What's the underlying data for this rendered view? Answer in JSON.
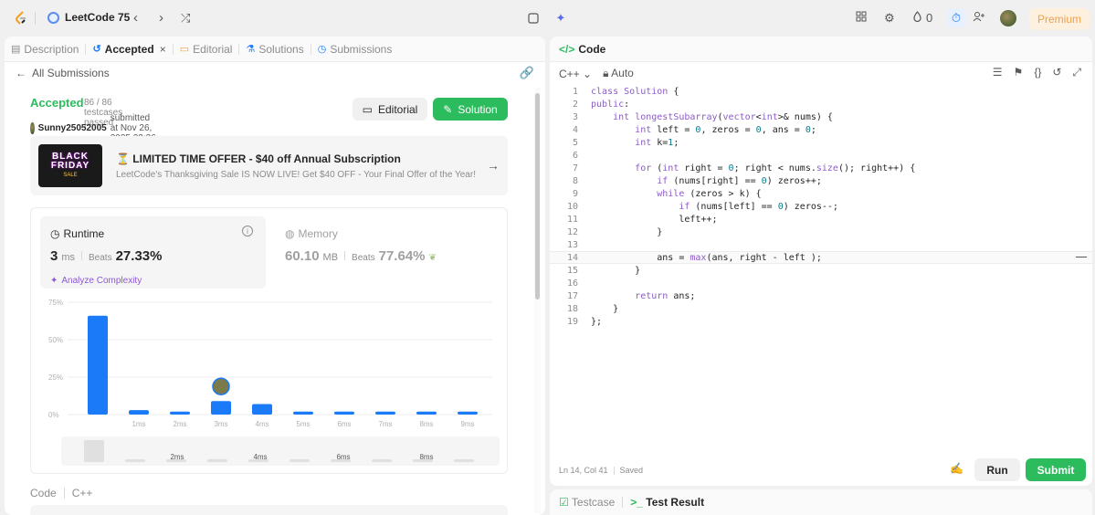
{
  "topbar": {
    "title": "LeetCode 75",
    "nav_prev": "‹",
    "nav_next": "›",
    "shuffle": "⤮",
    "streak_count": "0",
    "premium_label": "Premium"
  },
  "left_tabs": [
    {
      "label": "Description",
      "icon": "description-icon"
    },
    {
      "label": "Accepted",
      "icon": "history-icon"
    },
    {
      "label": "Editorial",
      "icon": "book-icon"
    },
    {
      "label": "Solutions",
      "icon": "flask-icon"
    },
    {
      "label": "Submissions",
      "icon": "clock-icon"
    }
  ],
  "left_tabs_close": "×",
  "submission": {
    "back_label": "All Submissions",
    "status": "Accepted",
    "testcases": "86 / 86 testcases passed",
    "user": "Sunny25052005",
    "submitted_text": "submitted at Nov 26, 2025 22:36",
    "editorial_btn": "Editorial",
    "solution_btn": "Solution"
  },
  "offer": {
    "image_line1": "BLACK",
    "image_line2": "FRIDAY",
    "image_line3": "SALE",
    "title": "⏳ LIMITED TIME OFFER - $40 off Annual Subscription",
    "subtitle": "LeetCode's Thanksgiving Sale IS NOW LIVE! Get $40 OFF - Your Final Offer of the Year!"
  },
  "runtime": {
    "label": "Runtime",
    "value": "3",
    "unit": "ms",
    "beats_label": "Beats",
    "beats": "27.33%",
    "analyze": "Analyze Complexity"
  },
  "memory": {
    "label": "Memory",
    "value": "60.10",
    "unit": "MB",
    "beats_label": "Beats",
    "beats": "77.64%"
  },
  "chart_data": {
    "type": "bar",
    "y_ticks": [
      "75%",
      "50%",
      "25%",
      "0%"
    ],
    "ylim": [
      0,
      75
    ],
    "categories": [
      "0ms",
      "1ms",
      "2ms",
      "3ms",
      "4ms",
      "5ms",
      "6ms",
      "7ms",
      "8ms",
      "9ms"
    ],
    "x_tick_labels": [
      "",
      "1ms",
      "2ms",
      "3ms",
      "4ms",
      "5ms",
      "6ms",
      "7ms",
      "8ms",
      "9ms"
    ],
    "values": [
      66,
      3,
      2,
      9,
      7,
      2,
      2,
      2,
      2,
      2
    ],
    "highlight_index": 3,
    "bar_color": "#1a7af8",
    "range_labels": [
      "2ms",
      "4ms",
      "6ms",
      "8ms"
    ]
  },
  "code_section": {
    "label": "Code",
    "lang": "C++"
  },
  "code_panel": {
    "title": "Code",
    "lang": "C++",
    "auto": "Auto",
    "lines": [
      "class Solution {",
      "public:",
      "    int longestSubarray(vector<int>& nums) {",
      "        int left = 0, zeros = 0, ans = 0;",
      "        int k=1;",
      "",
      "        for (int right = 0; right < nums.size(); right++) {",
      "            if (nums[right] == 0) zeros++;",
      "            while (zeros > k) {",
      "                if (nums[left] == 0) zeros--;",
      "                left++;",
      "            }",
      "",
      "            ans = max(ans, right - left );",
      "        }",
      "",
      "        return ans;",
      "    }",
      "};"
    ],
    "status_pos": "Ln 14, Col 41",
    "status_saved": "Saved",
    "run_btn": "Run",
    "submit_btn": "Submit"
  },
  "test_panel": {
    "testcase": "Testcase",
    "result": "Test Result"
  }
}
